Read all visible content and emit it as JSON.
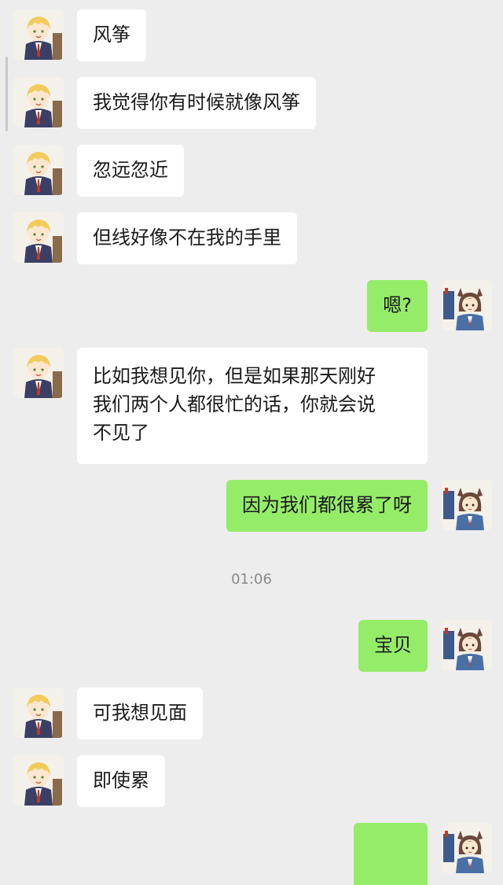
{
  "messages": [
    {
      "side": "in",
      "text": "风筝"
    },
    {
      "side": "in",
      "text": "我觉得你有时候就像风筝"
    },
    {
      "side": "in",
      "text": "忽远忽近"
    },
    {
      "side": "in",
      "text": "但线好像不在我的手里"
    },
    {
      "side": "out",
      "text": "嗯?"
    },
    {
      "side": "in",
      "lines": [
        "比如我想见你，但是如果那天刚好",
        "我们两个人都很忙的话，你就会说",
        "不见了"
      ]
    },
    {
      "side": "out",
      "text": "因为我们都很累了呀"
    },
    {
      "side": "out",
      "text": "宝贝"
    },
    {
      "side": "in",
      "text": "可我想见面"
    },
    {
      "side": "in",
      "text": "即使累"
    },
    {
      "side": "out",
      "text": ""
    }
  ],
  "timestamp": "01:06",
  "avatars": {
    "incoming": "blond-boy-avatar",
    "outgoing": "cat-ear-girl-avatar"
  },
  "colors": {
    "background": "#ededed",
    "incoming_bubble": "#ffffff",
    "outgoing_bubble": "#95ec69",
    "timestamp": "#8a8a8a"
  }
}
